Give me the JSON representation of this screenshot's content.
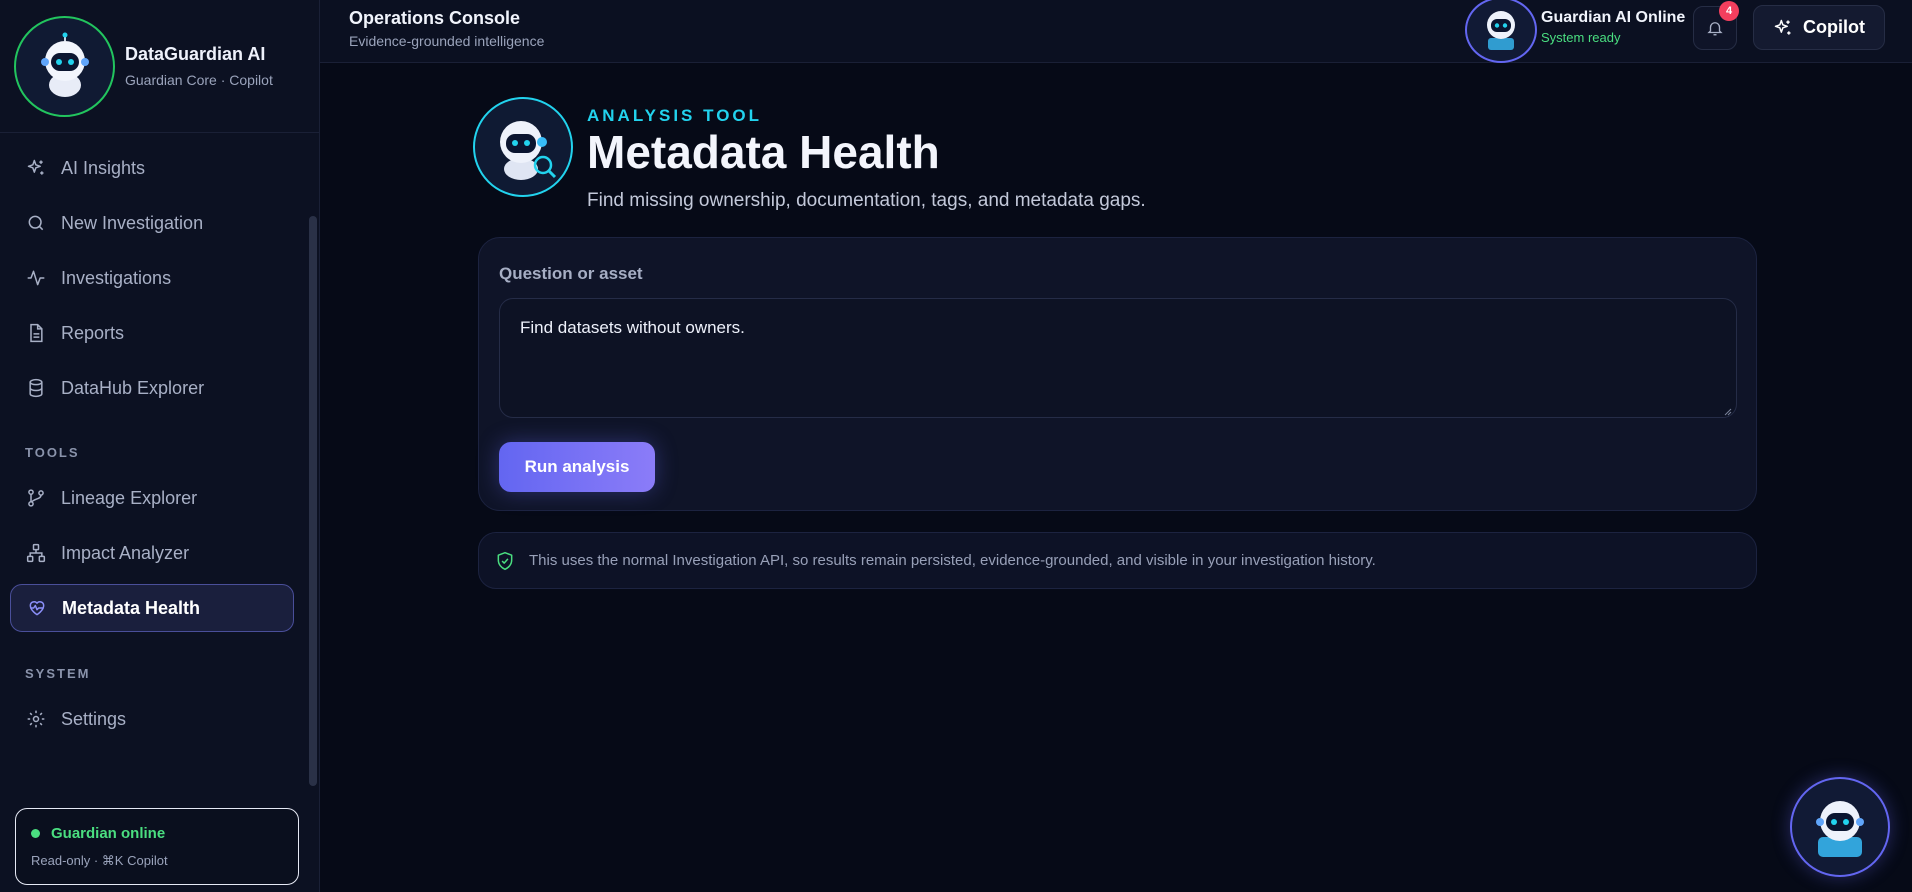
{
  "brand": {
    "title": "DataGuardian AI",
    "subtitle": "Guardian Core · Copilot"
  },
  "sidebar": {
    "items": [
      {
        "label": "AI Insights",
        "icon": "sparkles-icon"
      },
      {
        "label": "New Investigation",
        "icon": "search-icon"
      },
      {
        "label": "Investigations",
        "icon": "activity-icon"
      },
      {
        "label": "Reports",
        "icon": "document-icon"
      },
      {
        "label": "DataHub Explorer",
        "icon": "database-icon"
      }
    ],
    "tools_label": "TOOLS",
    "tools": [
      {
        "label": "Lineage Explorer",
        "icon": "git-branch-icon"
      },
      {
        "label": "Impact Analyzer",
        "icon": "network-icon"
      },
      {
        "label": "Metadata Health",
        "icon": "heart-pulse-icon",
        "active": true
      }
    ],
    "system_label": "SYSTEM",
    "system": [
      {
        "label": "Settings",
        "icon": "gear-icon"
      }
    ]
  },
  "status_card": {
    "title": "Guardian online",
    "subtitle": "Read-only · ⌘K Copilot"
  },
  "topbar": {
    "title": "Operations Console",
    "subtitle": "Evidence-grounded intelligence",
    "ai_status": "Guardian AI Online",
    "ai_state": "System ready",
    "notification_count": "4",
    "copilot_label": "Copilot"
  },
  "main": {
    "eyebrow": "ANALYSIS TOOL",
    "title": "Metadata Health",
    "subtitle": "Find missing ownership, documentation, tags, and metadata gaps.",
    "field_label": "Question or asset",
    "query_value": "Find datasets without owners.",
    "run_label": "Run analysis",
    "note": "This uses the normal Investigation API, so results remain persisted, evidence-grounded, and visible in your investigation history."
  },
  "colors": {
    "accent": "#6366f1",
    "cyan": "#22d3ee",
    "online": "#4ade80",
    "badge": "#f43f5e"
  }
}
